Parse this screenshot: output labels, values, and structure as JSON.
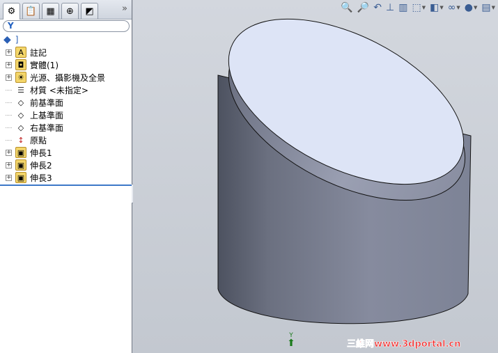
{
  "panel": {
    "tabs": [
      {
        "name": "feature-manager",
        "icon": "part-icon",
        "glyph": "⚙"
      },
      {
        "name": "property-manager",
        "icon": "property-icon",
        "glyph": "📋"
      },
      {
        "name": "configuration-manager",
        "icon": "configuration-icon",
        "glyph": "▦"
      },
      {
        "name": "dimxpert-manager",
        "icon": "crosshair-icon",
        "glyph": "⊕"
      },
      {
        "name": "display-manager",
        "icon": "display-icon",
        "glyph": "◩"
      }
    ],
    "more_label": "»",
    "filter_icon": "funnel-icon",
    "root_label": "]",
    "tree": [
      {
        "label": "註記",
        "expandable": true,
        "icon": "annotation-folder-icon",
        "glyph": "A"
      },
      {
        "label": "實體(1)",
        "expandable": true,
        "icon": "solid-bodies-folder-icon",
        "glyph": "◘"
      },
      {
        "label": "光源、攝影機及全景",
        "expandable": true,
        "icon": "lights-folder-icon",
        "glyph": "☀"
      },
      {
        "label": "材質 <未指定>",
        "expandable": false,
        "icon": "material-icon",
        "glyph": "☰"
      },
      {
        "label": "前基準面",
        "expandable": false,
        "icon": "plane-icon",
        "glyph": "◇"
      },
      {
        "label": "上基準面",
        "expandable": false,
        "icon": "plane-icon",
        "glyph": "◇"
      },
      {
        "label": "右基準面",
        "expandable": false,
        "icon": "plane-icon",
        "glyph": "◇"
      },
      {
        "label": "原點",
        "expandable": false,
        "icon": "origin-icon",
        "glyph": "↕"
      },
      {
        "label": "伸長1",
        "expandable": true,
        "icon": "extrude-icon",
        "glyph": "▣"
      },
      {
        "label": "伸長2",
        "expandable": true,
        "icon": "extrude-icon",
        "glyph": "▣"
      },
      {
        "label": "伸長3",
        "expandable": true,
        "icon": "extrude-icon",
        "glyph": "▣"
      }
    ]
  },
  "toolbar": [
    {
      "name": "zoom-to-fit",
      "glyph": "🔍",
      "dropdown": false
    },
    {
      "name": "zoom-to-area",
      "glyph": "🔎",
      "dropdown": false
    },
    {
      "name": "previous-view",
      "glyph": "↶",
      "dropdown": false
    },
    {
      "name": "section-view",
      "glyph": "⊥",
      "dropdown": false
    },
    {
      "name": "dynamic-annotation",
      "glyph": "▥",
      "dropdown": false
    },
    {
      "name": "view-orientation",
      "glyph": "⬚",
      "dropdown": true
    },
    {
      "name": "display-style",
      "glyph": "◧",
      "dropdown": true
    },
    {
      "name": "hide-show-items",
      "glyph": "∞",
      "dropdown": true
    },
    {
      "name": "edit-appearance",
      "glyph": "●",
      "dropdown": true
    },
    {
      "name": "apply-scene",
      "glyph": "▤",
      "dropdown": true
    }
  ],
  "triad": {
    "axis_label": "Y"
  },
  "watermark": "三維网www.3dportal.cn",
  "colors": {
    "top_face": "#dde4f6",
    "body": "#7d8396",
    "accent": "#3c78c8"
  }
}
